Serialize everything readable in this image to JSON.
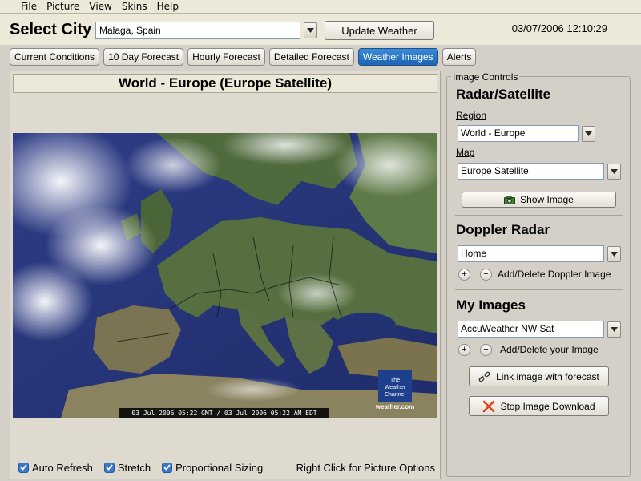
{
  "menu": [
    "File",
    "Picture",
    "View",
    "Skins",
    "Help"
  ],
  "city": {
    "title": "Select City",
    "value": "Malaga, Spain",
    "update_label": "Update Weather",
    "datetime": "03/07/2006 12:10:29"
  },
  "tabs": [
    {
      "label": "Current Conditions",
      "active": false
    },
    {
      "label": "10 Day Forecast",
      "active": false
    },
    {
      "label": "Hourly Forecast",
      "active": false
    },
    {
      "label": "Detailed Forecast",
      "active": false
    },
    {
      "label": "Weather Images",
      "active": true
    },
    {
      "label": "Alerts",
      "active": false
    }
  ],
  "image": {
    "title": "World - Europe (Europe Satellite)",
    "timestamp": "03 Jul 2006 05:22 GMT / 03 Jul 2006 05:22 AM EDT",
    "logo_lines": [
      "The",
      "Weather",
      "Channel"
    ],
    "logo_site": "weather.com"
  },
  "options": {
    "auto_refresh": "Auto Refresh",
    "stretch": "Stretch",
    "proportional": "Proportional Sizing",
    "hint": "Right Click for Picture Options"
  },
  "controls": {
    "legend": "Image Controls",
    "radar": {
      "title": "Radar/Satellite",
      "region_label": "Region",
      "region_value": "World - Europe",
      "map_label": "Map",
      "map_value": "Europe Satellite",
      "show_label": "Show Image"
    },
    "doppler": {
      "title": "Doppler Radar",
      "value": "Home",
      "add_delete": "Add/Delete Doppler Image"
    },
    "my_images": {
      "title": "My Images",
      "value": "AccuWeather NW Sat",
      "add_delete": "Add/Delete your Image",
      "link_label": "Link image with forecast",
      "stop_label": "Stop Image Download"
    }
  },
  "colors": {
    "accent": "#1d64b3",
    "stop_icon": "#e0401c"
  }
}
